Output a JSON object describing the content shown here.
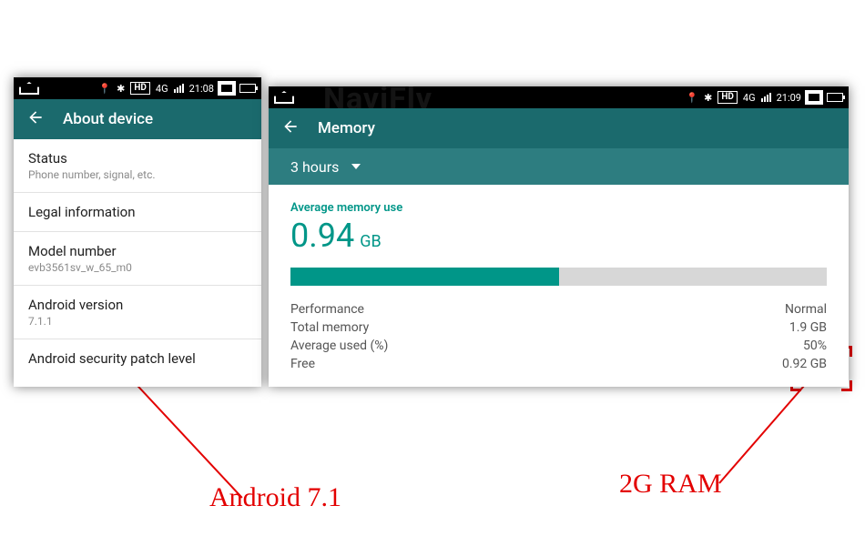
{
  "status": {
    "time_left": "21:08",
    "time_right": "21:09",
    "net_label": "4G",
    "hd": "HD"
  },
  "left": {
    "title": "About device",
    "items": [
      {
        "title": "Status",
        "sub": "Phone number, signal, etc."
      },
      {
        "title": "Legal information",
        "sub": ""
      },
      {
        "title": "Model number",
        "sub": "evb3561sv_w_65_m0"
      },
      {
        "title": "Android version",
        "sub": "7.1.1"
      },
      {
        "title": "Android security patch level",
        "sub": ""
      }
    ]
  },
  "right": {
    "title": "Memory",
    "range": "3 hours",
    "avg_label": "Average memory use",
    "avg_value": "0.94",
    "avg_unit": "GB",
    "bar_pct": 50,
    "stats": [
      {
        "k": "Performance",
        "v": "Normal"
      },
      {
        "k": "Total memory",
        "v": "1.9 GB"
      },
      {
        "k": "Average used (%)",
        "v": "50%"
      },
      {
        "k": "Free",
        "v": "0.92 GB"
      }
    ]
  },
  "callouts": {
    "android": "Android 7.1",
    "ram": "2G RAM"
  },
  "watermark": "NaviFly"
}
